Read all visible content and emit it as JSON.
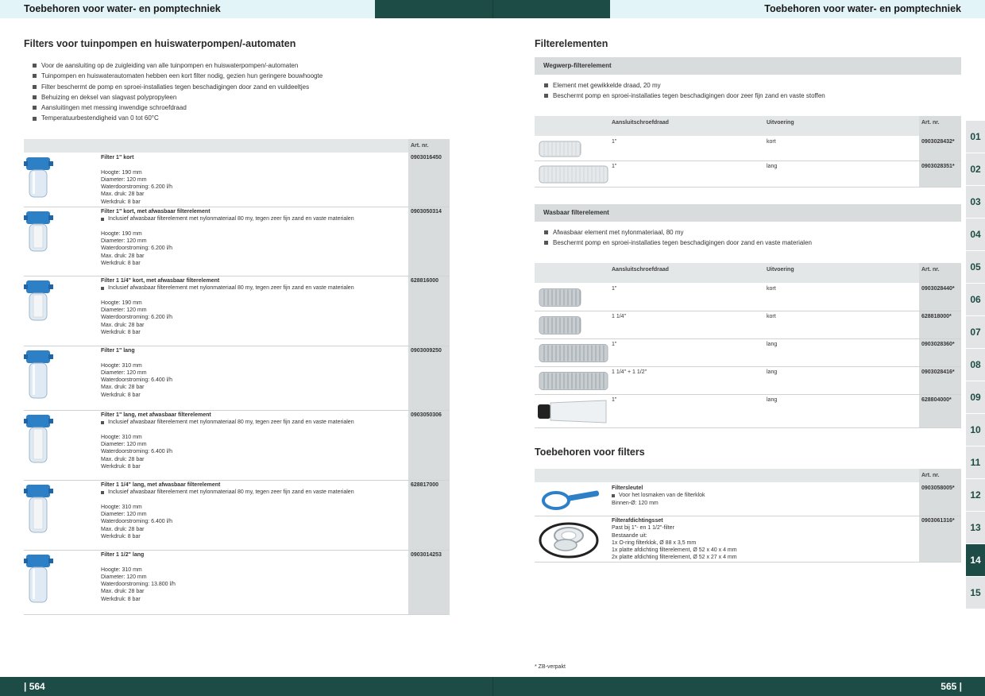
{
  "header": {
    "left_title": "Toebehoren voor water- en pomptechniek",
    "right_title": "Toebehoren voor water- en pomptechniek"
  },
  "footer": {
    "left_page": "| 564",
    "right_page": "565 |",
    "footnote": "* ZB-verpakt"
  },
  "left": {
    "title": "Filters voor tuinpompen en huiswaterpompen/-automaten",
    "bullets": [
      "Voor de aansluiting op de zuigleiding van alle tuinpompen en huiswaterpompen/-automaten",
      "Tuinpompen en huiswaterautomaten hebben een kort filter nodig, gezien hun geringere bouwhoogte",
      "Filter beschermt de pomp en sproei-installaties tegen beschadigingen door zand en vuildeeltjes",
      "Behuizing en deksel van slagvast polypropyleen",
      "Aansluitingen met messing inwendige schroefdraad",
      "Temperatuurbestendigheid van 0 tot 60°C"
    ],
    "art_header": "Art. nr.",
    "products": [
      {
        "name": "Filter 1\" kort",
        "bullet": "",
        "specs": [
          "Hoogte: 190 mm",
          "Diameter: 120 mm",
          "Waterdoorstroming: 6.200 l/h",
          "Max. druk: 28 bar",
          "Werkdruk: 8 bar"
        ],
        "art": "0903016450"
      },
      {
        "name": "Filter 1\" kort, met afwasbaar filterelement",
        "bullet": "Inclusief afwasbaar filterelement met nylonmateriaal 80 my, tegen zeer fijn zand en vaste materialen",
        "specs": [
          "Hoogte: 190 mm",
          "Diameter: 120 mm",
          "Waterdoorstroming: 6.200 l/h",
          "Max. druk: 28 bar",
          "Werkdruk: 8 bar"
        ],
        "art": "0903050314"
      },
      {
        "name": "Filter 1 1/4\" kort, met afwasbaar filterelement",
        "bullet": "Inclusief afwasbaar filterelement met nylonmateriaal 80 my, tegen zeer fijn zand en vaste materialen",
        "specs": [
          "Hoogte: 190 mm",
          "Diameter: 120 mm",
          "Waterdoorstroming: 6.200 l/h",
          "Max. druk: 28 bar",
          "Werkdruk: 8 bar"
        ],
        "art": "628816000"
      },
      {
        "name": "Filter 1\" lang",
        "bullet": "",
        "specs": [
          "Hoogte: 310 mm",
          "Diameter: 120 mm",
          "Waterdoorstroming: 6.400 l/h",
          "Max. druk: 28 bar",
          "Werkdruk: 8 bar"
        ],
        "art": "0903009250"
      },
      {
        "name": "Filter 1\" lang, met afwasbaar filterelement",
        "bullet": "Inclusief afwasbaar filterelement met nylonmateriaal 80 my, tegen zeer fijn zand en vaste materialen",
        "specs": [
          "Hoogte: 310 mm",
          "Diameter: 120 mm",
          "Waterdoorstroming: 6.400 l/h",
          "Max. druk: 28 bar",
          "Werkdruk: 8 bar"
        ],
        "art": "0903050306"
      },
      {
        "name": "Filter 1 1/4\" lang, met afwasbaar filterelement",
        "bullet": "Inclusief afwasbaar filterelement met nylonmateriaal 80 my, tegen zeer fijn zand en vaste materialen",
        "specs": [
          "Hoogte: 310 mm",
          "Diameter: 120 mm",
          "Waterdoorstroming: 6.400 l/h",
          "Max. druk: 28 bar",
          "Werkdruk: 8 bar"
        ],
        "art": "628817000"
      },
      {
        "name": "Filter 1 1/2\" lang",
        "bullet": "",
        "specs": [
          "Hoogte: 310 mm",
          "Diameter: 120 mm",
          "Waterdoorstroming: 13.800 l/h",
          "Max. druk: 28 bar",
          "Werkdruk: 8 bar"
        ],
        "art": "0903014253"
      }
    ]
  },
  "right": {
    "title": "Filterelementen",
    "group1": {
      "title": "Wegwerp-filterelement",
      "bullets": [
        "Element met gewikkelde draad, 20 my",
        "Beschermt pomp en sproei-installaties tegen beschadigingen door zeer fijn zand en vaste stoffen"
      ],
      "headers": {
        "thread": "Aansluitschroefdraad",
        "version": "Uitvoering",
        "art": "Art. nr."
      },
      "rows": [
        {
          "thread": "1\"",
          "version": "kort",
          "art": "0903028432*"
        },
        {
          "thread": "1\"",
          "version": "lang",
          "art": "0903028351*"
        }
      ]
    },
    "group2": {
      "title": "Wasbaar filterelement",
      "bullets": [
        "Afwasbaar element met nylonmateriaal, 80 my",
        "Beschermt pomp en sproei-installaties tegen beschadigingen door zand en vaste materialen"
      ],
      "headers": {
        "thread": "Aansluitschroefdraad",
        "version": "Uitvoering",
        "art": "Art. nr."
      },
      "rows": [
        {
          "thread": "1\"",
          "version": "kort",
          "art": "0903028440*"
        },
        {
          "thread": "1 1/4\"",
          "version": "kort",
          "art": "628818000*"
        },
        {
          "thread": "1\"",
          "version": "lang",
          "art": "0903028360*"
        },
        {
          "thread": "1 1/4\" + 1 1/2\"",
          "version": "lang",
          "art": "0903028416*"
        },
        {
          "thread": "1\"",
          "version": "lang",
          "art": "628804000*"
        }
      ]
    },
    "accessories": {
      "title": "Toebehoren voor filters",
      "art_header": "Art. nr.",
      "items": [
        {
          "name": "Filtersleutel",
          "bullet": "Voor het losmaken van de filterklok",
          "lines": [
            "Binnen-Ø: 120 mm"
          ],
          "art": "0903058005*"
        },
        {
          "name": "Filterafdichtingsset",
          "bullet": "",
          "lines": [
            "Past bij 1\"- en 1 1/2\"-filter",
            "Bestaande uit:",
            "1x O-ring filterklok, Ø 88 x 3,5 mm",
            "1x platte afdichting filterelement, Ø 52 x 40 x 4 mm",
            "2x platte afdichting filterelement, Ø 52 x 27 x 4 mm"
          ],
          "art": "0903061316*"
        }
      ]
    }
  },
  "tabs": [
    "01",
    "02",
    "03",
    "04",
    "05",
    "06",
    "07",
    "08",
    "09",
    "10",
    "11",
    "12",
    "13",
    "14",
    "15"
  ],
  "active_tab": "14",
  "colors": {
    "dark_green": "#1c4c45",
    "light_cyan": "#e2f4f7",
    "filter_blue": "#2d7fc6",
    "grey_bar": "#d9dcdd"
  }
}
